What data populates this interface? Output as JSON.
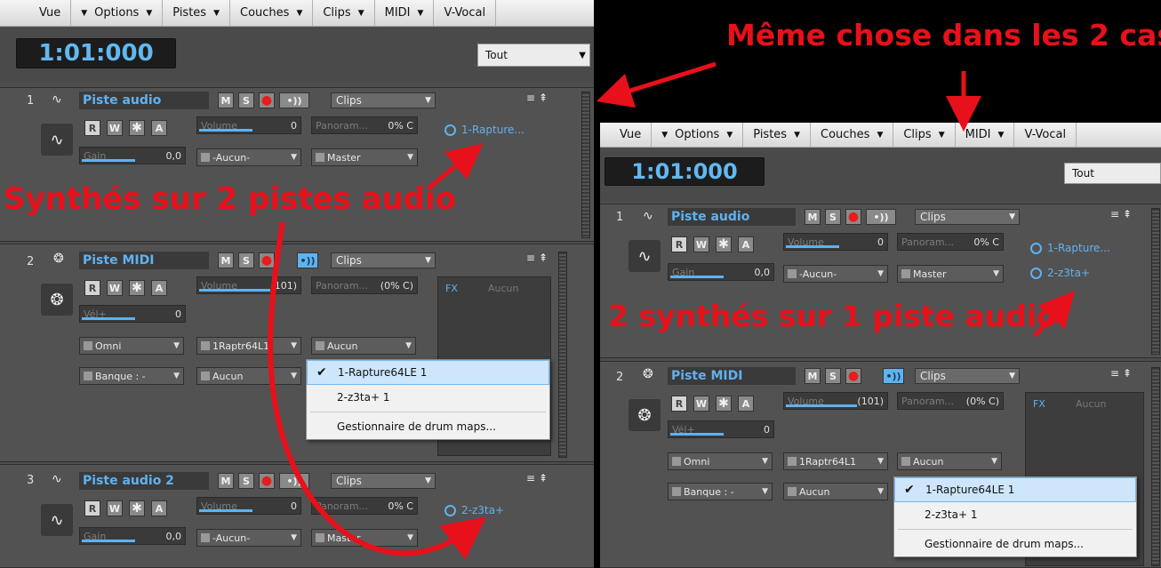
{
  "menu": {
    "items": [
      {
        "label": "Vue"
      },
      {
        "label": "Options"
      },
      {
        "label": "Pistes"
      },
      {
        "label": "Couches"
      },
      {
        "label": "Clips"
      },
      {
        "label": "MIDI"
      },
      {
        "label": "V-Vocal"
      }
    ]
  },
  "transport": {
    "time": "1:01:000",
    "filter": "Tout"
  },
  "tracks": [
    {
      "num": "1",
      "name": "Piste audio",
      "volume_label": "Volume",
      "volume_value": "0",
      "pan_label": "Panoram...",
      "pan_value": "0% C",
      "gain_label": "Gain",
      "gain_value": "0,0",
      "input": "-Aucun-",
      "output": "Master",
      "synth1": "1-Rapture...",
      "synth2": "2-z3ta+"
    },
    {
      "num": "2",
      "name": "Piste MIDI",
      "volume_label": "Volume",
      "volume_value": "(101)",
      "pan_label": "Panoram...",
      "pan_value": "(0% C)",
      "vel_label": "Vél+",
      "vel_value": "0",
      "input": "Omni",
      "output": "1Raptr64L1",
      "channel": "Aucun",
      "bank": "Banque : -",
      "patch": "Aucun",
      "fx_label": "FX",
      "fx_value": "Aucun"
    },
    {
      "num": "3",
      "name": "Piste audio 2",
      "volume_label": "Volume",
      "volume_value": "0",
      "pan_label": "Panoram...",
      "pan_value": "0% C",
      "gain_label": "Gain",
      "gain_value": "0,0",
      "input": "-Aucun-",
      "output": "Master",
      "synth": "2-z3ta+"
    }
  ],
  "buttons": {
    "m": "M",
    "s": "S",
    "r": "R",
    "w": "W",
    "a": "A",
    "clips": "Clips"
  },
  "popup": {
    "items": [
      "1-Rapture64LE 1",
      "2-z3ta+ 1",
      "Gestionnaire de drum maps..."
    ]
  },
  "annotations": {
    "top": "Même chose dans les 2 cas",
    "left": "Synthés sur 2 pistes audio",
    "right": "2 synthés sur 1 piste audio"
  },
  "colors": {
    "accent": "#5fb2f0",
    "annotation": "#e8101a",
    "record": "#e81c1c"
  }
}
